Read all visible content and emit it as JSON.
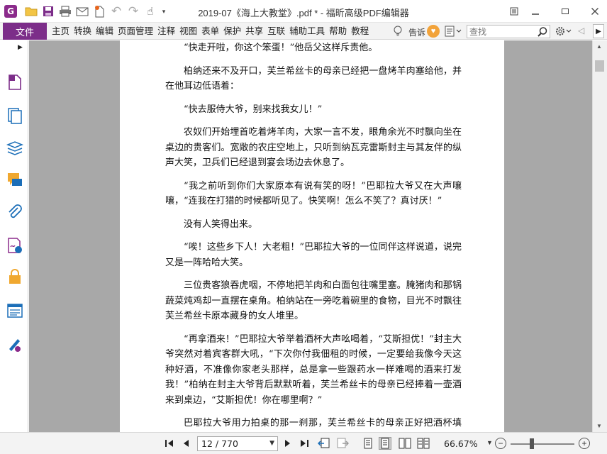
{
  "window": {
    "title": "2019-07《海上大教堂》.pdf * - 福昕高级PDF编辑器",
    "app_logo_letter": "G"
  },
  "quick_access": {
    "icons": [
      "open-folder-icon",
      "save-icon",
      "print-icon",
      "email-icon",
      "new-icon",
      "undo-icon",
      "redo-icon",
      "hand-tool-icon",
      "customize-dropdown-icon"
    ]
  },
  "window_controls": {
    "restore_icon": "restore-icon",
    "minimize_icon": "minimize-icon",
    "maximize_icon": "maximize-icon",
    "close_icon": "close-icon"
  },
  "menubar": {
    "file_label": "文件",
    "items": [
      "主页",
      "转换",
      "编辑",
      "页面管理",
      "注释",
      "视图",
      "表单",
      "保护",
      "共享",
      "互联",
      "辅助工具",
      "帮助",
      "教程"
    ],
    "tell_me_label": "告诉",
    "search_placeholder": "查找",
    "accent_color": "#7c2d89"
  },
  "left_panel": {
    "icons": [
      "page-thumbnails-icon",
      "pages-icon",
      "layers-icon",
      "comments-icon",
      "attachments-icon",
      "signature-icon",
      "security-lock-icon",
      "form-fields-icon",
      "certification-icon"
    ]
  },
  "document": {
    "paragraphs": [
      "“快走开啦，你这个笨蛋！”他岳父这样斥责他。",
      "柏纳还来不及开口，芙兰希丝卡的母亲已经把一盘烤羊肉塞给他，并在他耳边低语着：",
      "“快去服侍大爷，别来找我女儿！”",
      "农奴们开始埋首吃着烤羊肉，大家一言不发，眼角余光不时飘向坐在桌边的贵客们。宽敞的农庄空地上，只听到纳瓦克雷斯封主与其友伴的纵声大笑，卫兵们已经退到宴会场边去休息了。",
      "“我之前听到你们大家原本有说有笑的呀！”巴耶拉大爷又在大声嚷嚷，“连我在打猎的时候都听见了。快笑啊！怎么不笑了？真讨厌！”",
      "没有人笑得出来。",
      "“唉！这些乡下人！大老粗！”巴耶拉大爷的一位同伴这样说道，说完又是一阵哈哈大笑。",
      "三位贵客狼吞虎咽，不停地把羊肉和白面包往嘴里塞。腌猪肉和那锅蔬菜炖鸡却一直摆在桌角。柏纳站在一旁吃着碗里的食物，目光不时飘往芙兰希丝卡原本藏身的女人堆里。",
      "“再拿酒来！”巴耶拉大爷举着酒杯大声吆喝着，“艾斯担优！”封主大爷突然对着宾客群大吼，“下次你付我佃租的时候，一定要给我像今天这种好酒，不准像你家老头那样，总是拿一些跟药水一样难喝的酒来打发我！”柏纳在封主大爷背后默默听着，芙兰希丝卡的母亲已经捧着一壶酒来到桌边，“艾斯担优！你在哪里啊？”",
      "巴耶拉大爷用力拍桌的那一刹那，芙兰希丝卡的母亲正好把酒杯填满，美酒飞溅四散，落了好几滴在罗伦·巴耶拉的衣服上。这时候，柏"
    ]
  },
  "statusbar": {
    "page_display": "12 / 770",
    "zoom_label": "66.67%",
    "zoom_level_percent": 66.67
  }
}
